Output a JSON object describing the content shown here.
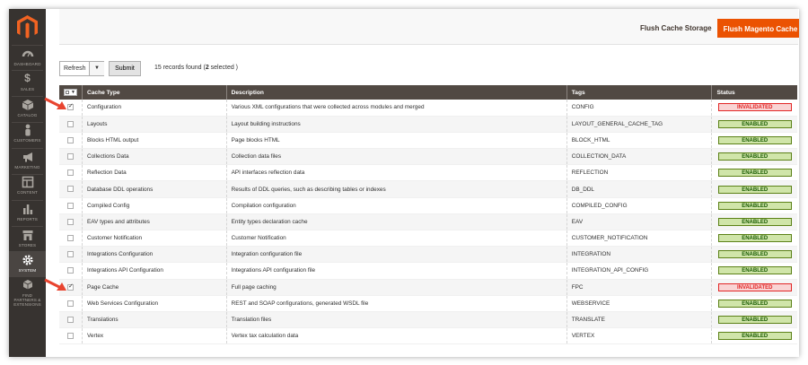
{
  "sidebar": {
    "items": [
      {
        "label": "Dashboard",
        "icon": "dashboard-icon"
      },
      {
        "label": "Sales",
        "icon": "dollar-icon"
      },
      {
        "label": "Catalog",
        "icon": "box-icon"
      },
      {
        "label": "Customers",
        "icon": "person-icon"
      },
      {
        "label": "Marketing",
        "icon": "megaphone-icon"
      },
      {
        "label": "Content",
        "icon": "layout-icon"
      },
      {
        "label": "Reports",
        "icon": "bar-chart-icon"
      },
      {
        "label": "Stores",
        "icon": "store-icon"
      },
      {
        "label": "System",
        "icon": "gear-icon"
      },
      {
        "label": "Find Partners & Extensions",
        "icon": "cubes-icon"
      }
    ]
  },
  "header": {
    "flush_storage": "Flush Cache Storage",
    "flush_magento": "Flush Magento Cache"
  },
  "toolbar": {
    "action_value": "Refresh",
    "submit_label": "Submit",
    "records_prefix": "15 records found (",
    "selected_count": "2",
    "records_suffix": " selected )"
  },
  "grid": {
    "columns": {
      "type": "Cache Type",
      "description": "Description",
      "tags": "Tags",
      "status": "Status"
    },
    "rows": [
      {
        "checked": true,
        "type": "Configuration",
        "description": "Various XML configurations that were collected across modules and merged",
        "tags": "CONFIG",
        "status": "INVALIDATED"
      },
      {
        "checked": false,
        "type": "Layouts",
        "description": "Layout building instructions",
        "tags": "LAYOUT_GENERAL_CACHE_TAG",
        "status": "ENABLED"
      },
      {
        "checked": false,
        "type": "Blocks HTML output",
        "description": "Page blocks HTML",
        "tags": "BLOCK_HTML",
        "status": "ENABLED"
      },
      {
        "checked": false,
        "type": "Collections Data",
        "description": "Collection data files",
        "tags": "COLLECTION_DATA",
        "status": "ENABLED"
      },
      {
        "checked": false,
        "type": "Reflection Data",
        "description": "API interfaces reflection data",
        "tags": "REFLECTION",
        "status": "ENABLED"
      },
      {
        "checked": false,
        "type": "Database DDL operations",
        "description": "Results of DDL queries, such as describing tables or indexes",
        "tags": "DB_DDL",
        "status": "ENABLED"
      },
      {
        "checked": false,
        "type": "Compiled Config",
        "description": "Compilation configuration",
        "tags": "COMPILED_CONFIG",
        "status": "ENABLED"
      },
      {
        "checked": false,
        "type": "EAV types and attributes",
        "description": "Entity types declaration cache",
        "tags": "EAV",
        "status": "ENABLED"
      },
      {
        "checked": false,
        "type": "Customer Notification",
        "description": "Customer Notification",
        "tags": "CUSTOMER_NOTIFICATION",
        "status": "ENABLED"
      },
      {
        "checked": false,
        "type": "Integrations Configuration",
        "description": "Integration configuration file",
        "tags": "INTEGRATION",
        "status": "ENABLED"
      },
      {
        "checked": false,
        "type": "Integrations API Configuration",
        "description": "Integrations API configuration file",
        "tags": "INTEGRATION_API_CONFIG",
        "status": "ENABLED"
      },
      {
        "checked": true,
        "type": "Page Cache",
        "description": "Full page caching",
        "tags": "FPC",
        "status": "INVALIDATED"
      },
      {
        "checked": false,
        "type": "Web Services Configuration",
        "description": "REST and SOAP configurations, generated WSDL file",
        "tags": "WEBSERVICE",
        "status": "ENABLED"
      },
      {
        "checked": false,
        "type": "Translations",
        "description": "Translation files",
        "tags": "TRANSLATE",
        "status": "ENABLED"
      },
      {
        "checked": false,
        "type": "Vertex",
        "description": "Vertex tax calculation data",
        "tags": "VERTEX",
        "status": "ENABLED"
      }
    ]
  },
  "colors": {
    "sidebar_bg": "#373330",
    "accent": "#eb5202",
    "header_bg": "#514943",
    "enabled_bg": "#d0e5a9",
    "invalid_text": "#e22626",
    "arrow": "#e8442f"
  }
}
